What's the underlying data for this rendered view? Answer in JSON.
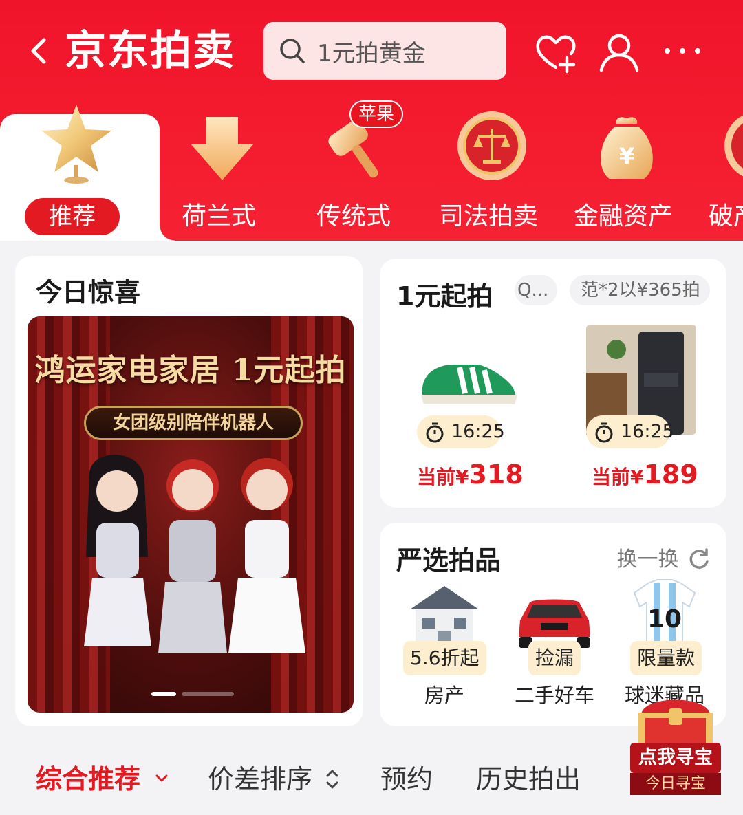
{
  "header": {
    "back_icon": "chevron-left-icon",
    "title": "京东拍卖",
    "search_placeholder": "1元拍黄金",
    "icons": [
      "heart-plus-icon",
      "user-icon",
      "more-icon"
    ]
  },
  "categories": {
    "items": [
      {
        "label": "推荐",
        "icon": "star-icon",
        "active": true
      },
      {
        "label": "荷兰式",
        "icon": "down-arrow-icon"
      },
      {
        "label": "传统式",
        "icon": "gavel-icon",
        "badge": "苹果"
      },
      {
        "label": "司法拍卖",
        "icon": "court-emblem-icon"
      },
      {
        "label": "金融资产",
        "icon": "money-bag-icon"
      },
      {
        "label": "破产",
        "icon": "partial-icon"
      }
    ]
  },
  "surprise": {
    "title": "今日惊喜",
    "banner_headline": "鸿运家电家居 1元起拍",
    "banner_subtitle": "女团级别陪伴机器人"
  },
  "one_yuan": {
    "title": "1元起拍",
    "chip_left": "Q...",
    "chip_right": "范*2以¥365拍",
    "products": [
      {
        "timer": "16:25",
        "price_prefix": "当前¥",
        "price": "318",
        "icon": "sneaker-icon"
      },
      {
        "timer": "16:25",
        "price_prefix": "当前¥",
        "price": "189",
        "icon": "water-dispenser-icon"
      }
    ]
  },
  "select": {
    "title": "严选拍品",
    "swap_label": "换一换",
    "items": [
      {
        "badge": "5.6折起",
        "label": "房产",
        "icon": "house-icon"
      },
      {
        "badge": "捡漏",
        "label": "二手好车",
        "icon": "car-icon"
      },
      {
        "badge": "限量款",
        "label": "球迷藏品",
        "icon": "jersey-icon"
      }
    ]
  },
  "sort": {
    "items": [
      {
        "label": "综合推荐",
        "active": true
      },
      {
        "label": "价差排序"
      },
      {
        "label": "预约"
      },
      {
        "label": "历史拍出"
      }
    ]
  },
  "treasure": {
    "label": "点我寻宝",
    "sub_label": "今日寻宝"
  },
  "colors": {
    "brand_red": "#e41a22",
    "header_red": "#f0142a",
    "pill_yellow": "#fdeed0"
  }
}
